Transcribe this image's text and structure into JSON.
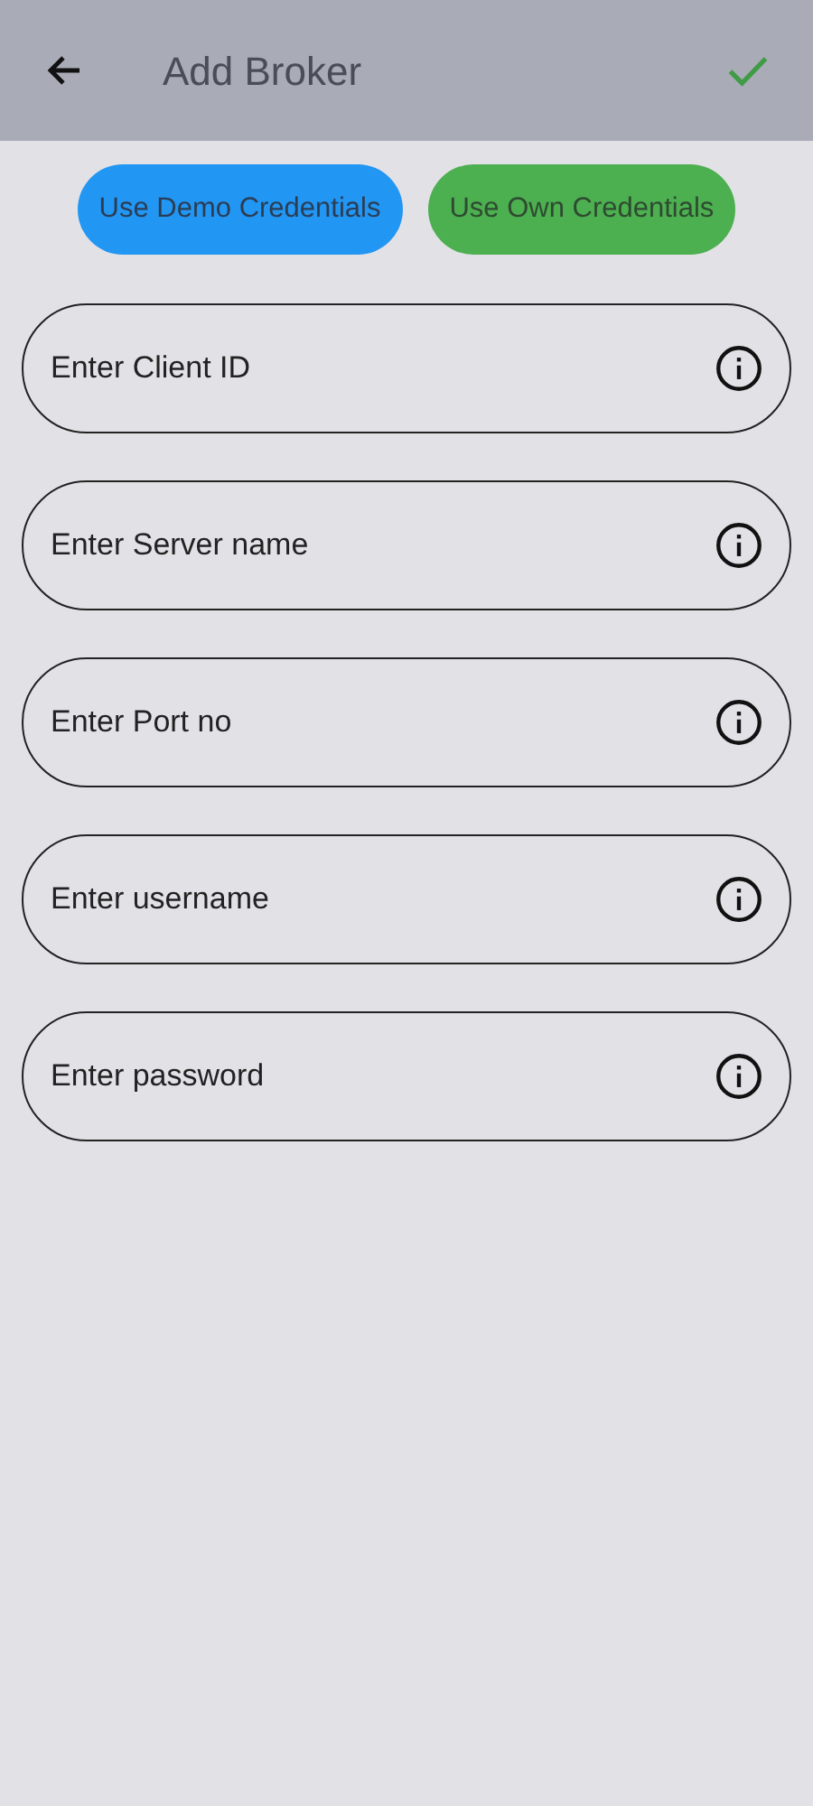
{
  "app_bar": {
    "title": "Add Broker"
  },
  "credential_buttons": [
    {
      "label": "Use Demo Credentials",
      "kind": "demo"
    },
    {
      "label": "Use Own Credentials",
      "kind": "own"
    }
  ],
  "fields": [
    {
      "placeholder": "Enter Client ID"
    },
    {
      "placeholder": "Enter Server name"
    },
    {
      "placeholder": "Enter Port no"
    },
    {
      "placeholder": "Enter username"
    },
    {
      "placeholder": "Enter password"
    }
  ]
}
